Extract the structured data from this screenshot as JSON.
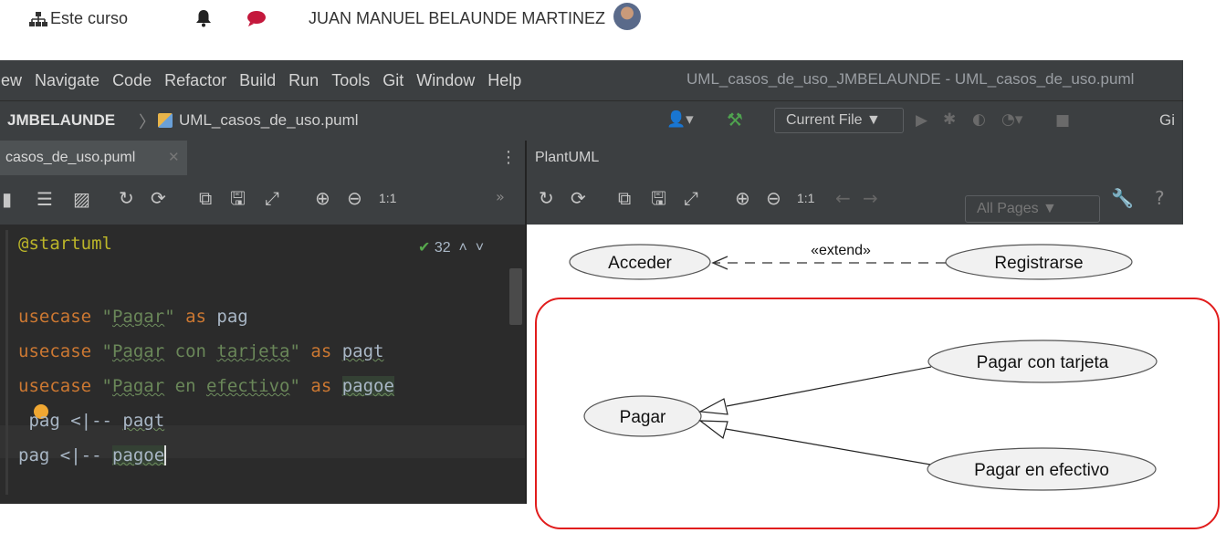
{
  "top": {
    "course_label": "Este curso",
    "user_name": "JUAN MANUEL BELAUNDE MARTINEZ"
  },
  "menu": {
    "items": [
      "iew",
      "Navigate",
      "Code",
      "Refactor",
      "Build",
      "Run",
      "Tools",
      "Git",
      "Window",
      "Help"
    ],
    "window_title": "UML_casos_de_uso_JMBELAUNDE - UML_casos_de_uso.puml"
  },
  "nav": {
    "project": "JMBELAUNDE",
    "file": "UML_casos_de_uso.puml",
    "run_config": "Current File ▼",
    "git_label": "Gi"
  },
  "editor": {
    "tab": "casos_de_uso.puml",
    "inspection_count": "32",
    "lines": [
      "@startuml",
      "",
      "usecase \"Pagar\" as pag",
      "usecase \"Pagar con tarjeta\" as pagt",
      "usecase \"Pagar en efectivo\" as pagoe",
      "pag <|-- pagt",
      "pag <|-- pagoe"
    ]
  },
  "plantuml": {
    "title": "PlantUML",
    "page_select": "All Pages ▼",
    "zoom_1to1": "1:1"
  },
  "diagram": {
    "usecases": {
      "acceder": "Acceder",
      "registrarse": "Registrarse",
      "pagar": "Pagar",
      "pagar_tarjeta": "Pagar con tarjeta",
      "pagar_efectivo": "Pagar en efectivo"
    },
    "extend_label": "«extend»",
    "highlight_color": "#e11d1d"
  }
}
